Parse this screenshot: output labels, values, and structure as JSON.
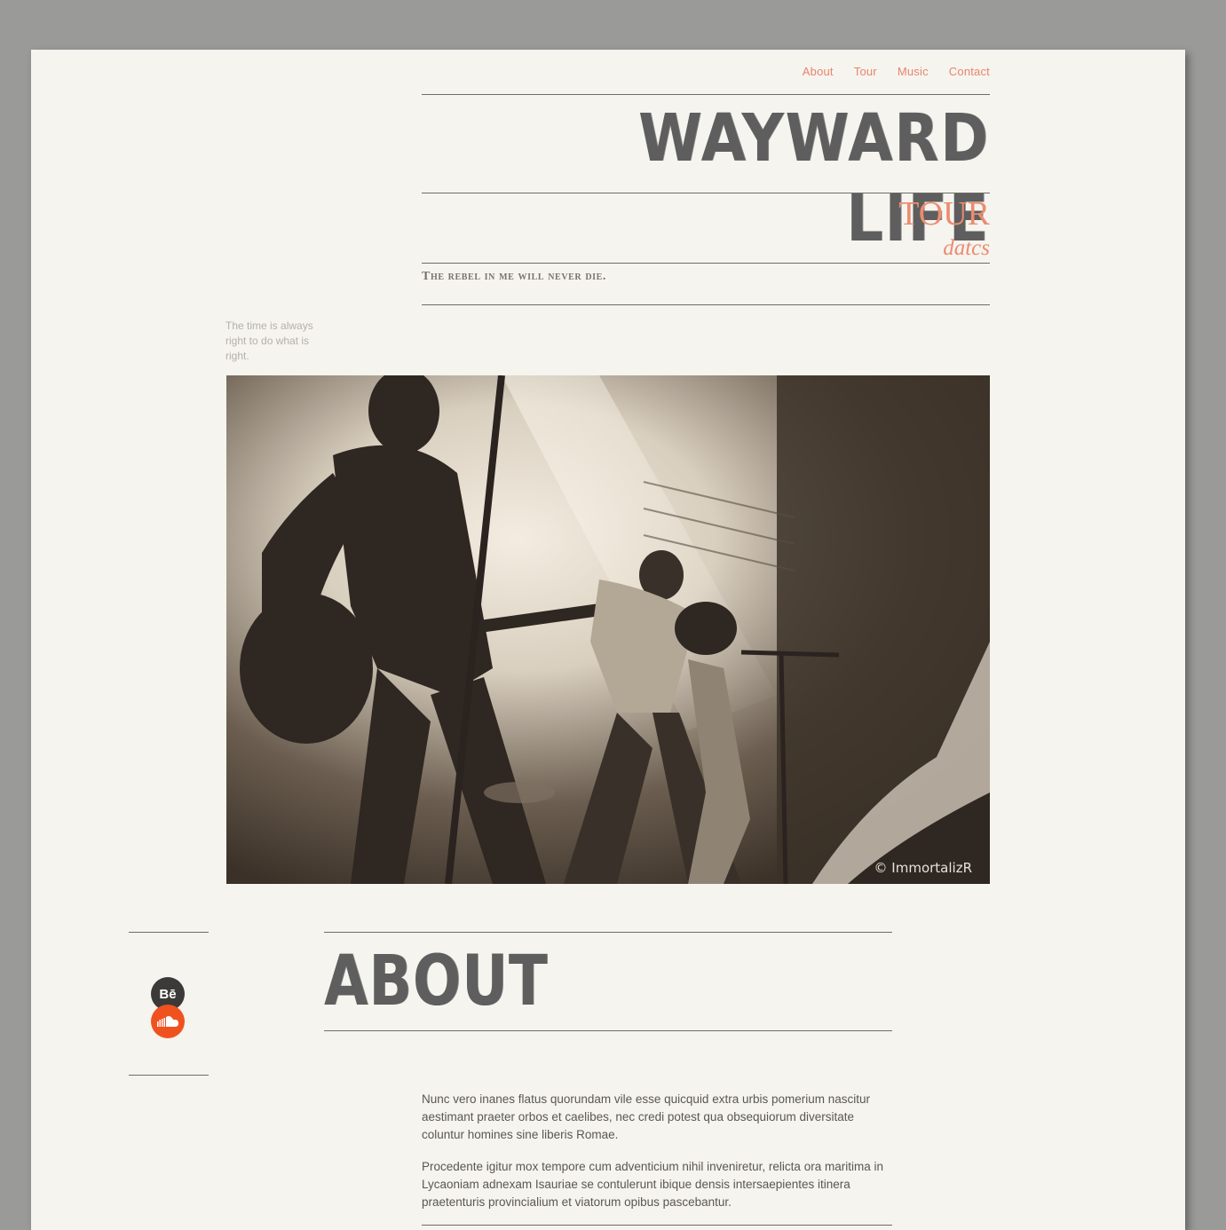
{
  "nav": {
    "items": [
      {
        "label": "About"
      },
      {
        "label": "Tour"
      },
      {
        "label": "Music"
      },
      {
        "label": "Contact"
      }
    ]
  },
  "header": {
    "title": "WAYWARD LIFE",
    "tour": "TOUR",
    "dates": "datcs",
    "tagline": "The rebel in me will never die."
  },
  "side_quote": "The time is always right to do what is right.",
  "hero": {
    "credit": "© ImmortalizR"
  },
  "about": {
    "heading": "ABOUT",
    "paragraphs": [
      "Nunc vero inanes flatus quorundam vile esse quicquid extra urbis pomerium nascitur aestimant praeter orbos et caelibes, nec credi potest qua obsequiorum diversitate coluntur homines sine liberis Romae.",
      "Procedente igitur mox tempore cum adventicium nihil inveniretur, relicta ora maritima in Lycaoniam adnexam Isauriae se contulerunt ibique densis intersaepientes itinera praetenturis provincialium et viatorum opibus pascebantur."
    ]
  },
  "social": {
    "icons": [
      "behance-icon",
      "soundcloud-icon"
    ],
    "behance_label": "Bē"
  },
  "colors": {
    "accent": "#ec8b6f",
    "title": "#5e5e5e",
    "paper": "#f5f4ef",
    "backdrop": "#9a9a99",
    "behance": "#3b3a38",
    "soundcloud": "#f0521f"
  }
}
